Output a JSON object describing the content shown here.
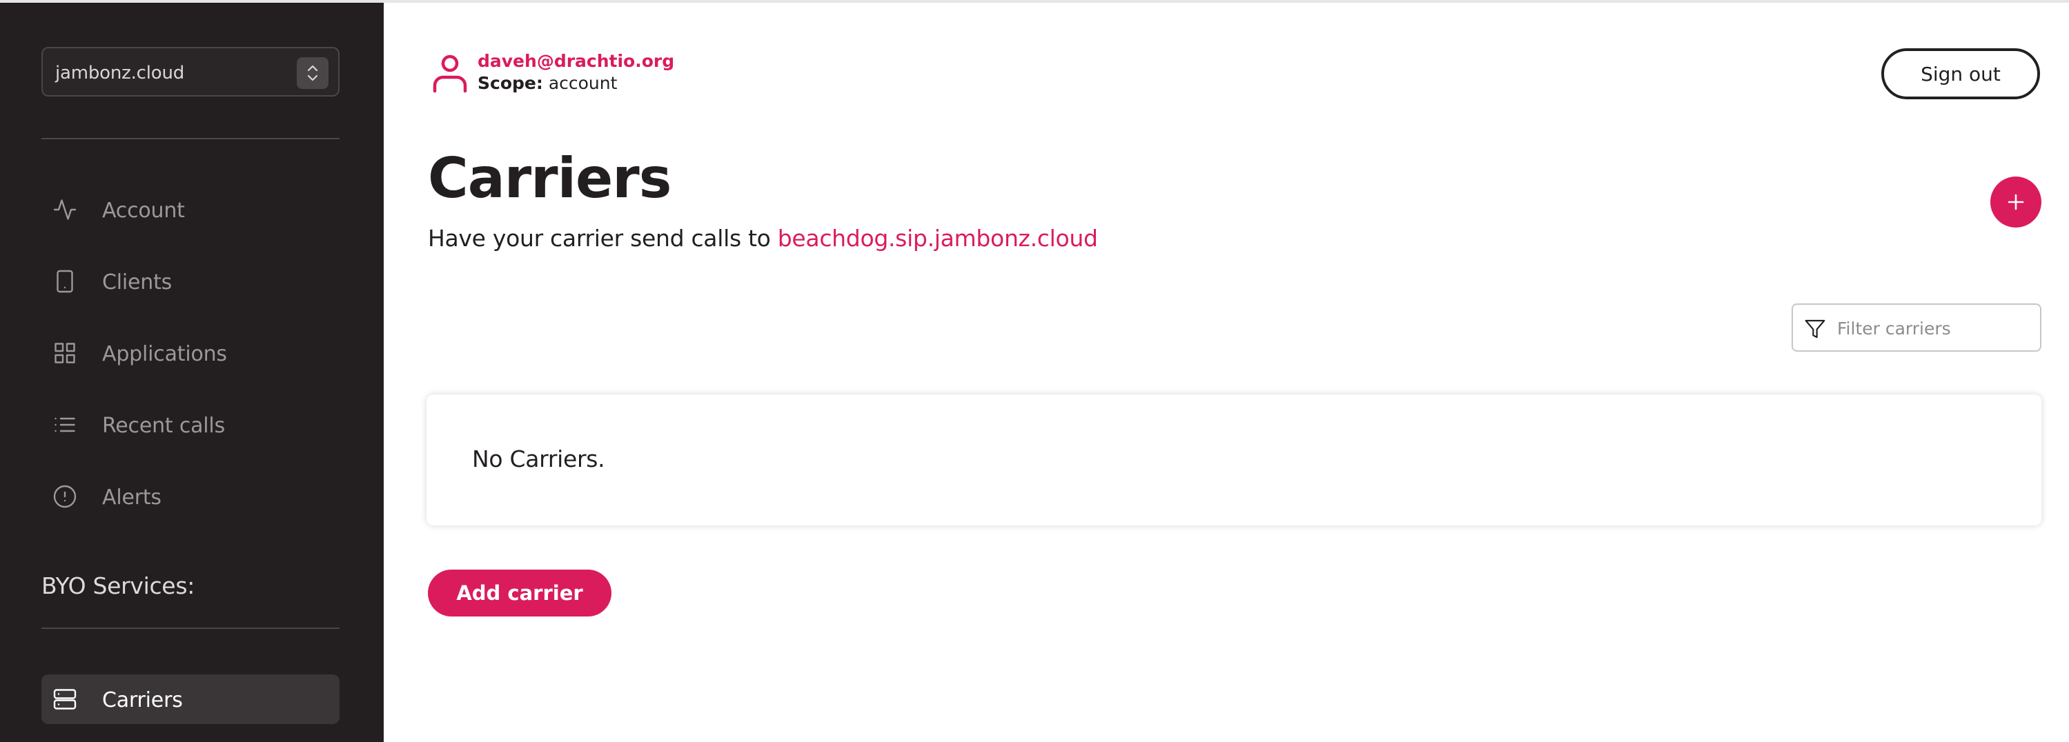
{
  "sidebar": {
    "account_selector": {
      "value": "jambonz.cloud"
    },
    "nav": [
      {
        "label": "Account",
        "icon": "activity-icon"
      },
      {
        "label": "Clients",
        "icon": "smartphone-icon"
      },
      {
        "label": "Applications",
        "icon": "grid-icon"
      },
      {
        "label": "Recent calls",
        "icon": "list-icon"
      },
      {
        "label": "Alerts",
        "icon": "alert-circle-icon"
      }
    ],
    "section_label": "BYO Services:",
    "byo_nav": [
      {
        "label": "Carriers",
        "icon": "server-icon",
        "active": true
      }
    ]
  },
  "header": {
    "email": "daveh@drachtio.org",
    "scope_label": "Scope:",
    "scope_value": "account",
    "sign_out_label": "Sign out"
  },
  "main": {
    "title": "Carriers",
    "subtitle_prefix": "Have your carrier send calls to",
    "subtitle_link": "beachdog.sip.jambonz.cloud",
    "filter_placeholder": "Filter carriers",
    "empty_text": "No Carriers.",
    "add_button_label": "Add carrier"
  },
  "colors": {
    "accent": "#da1c5c",
    "sidebar_bg": "#231f20",
    "text": "#231f20"
  }
}
